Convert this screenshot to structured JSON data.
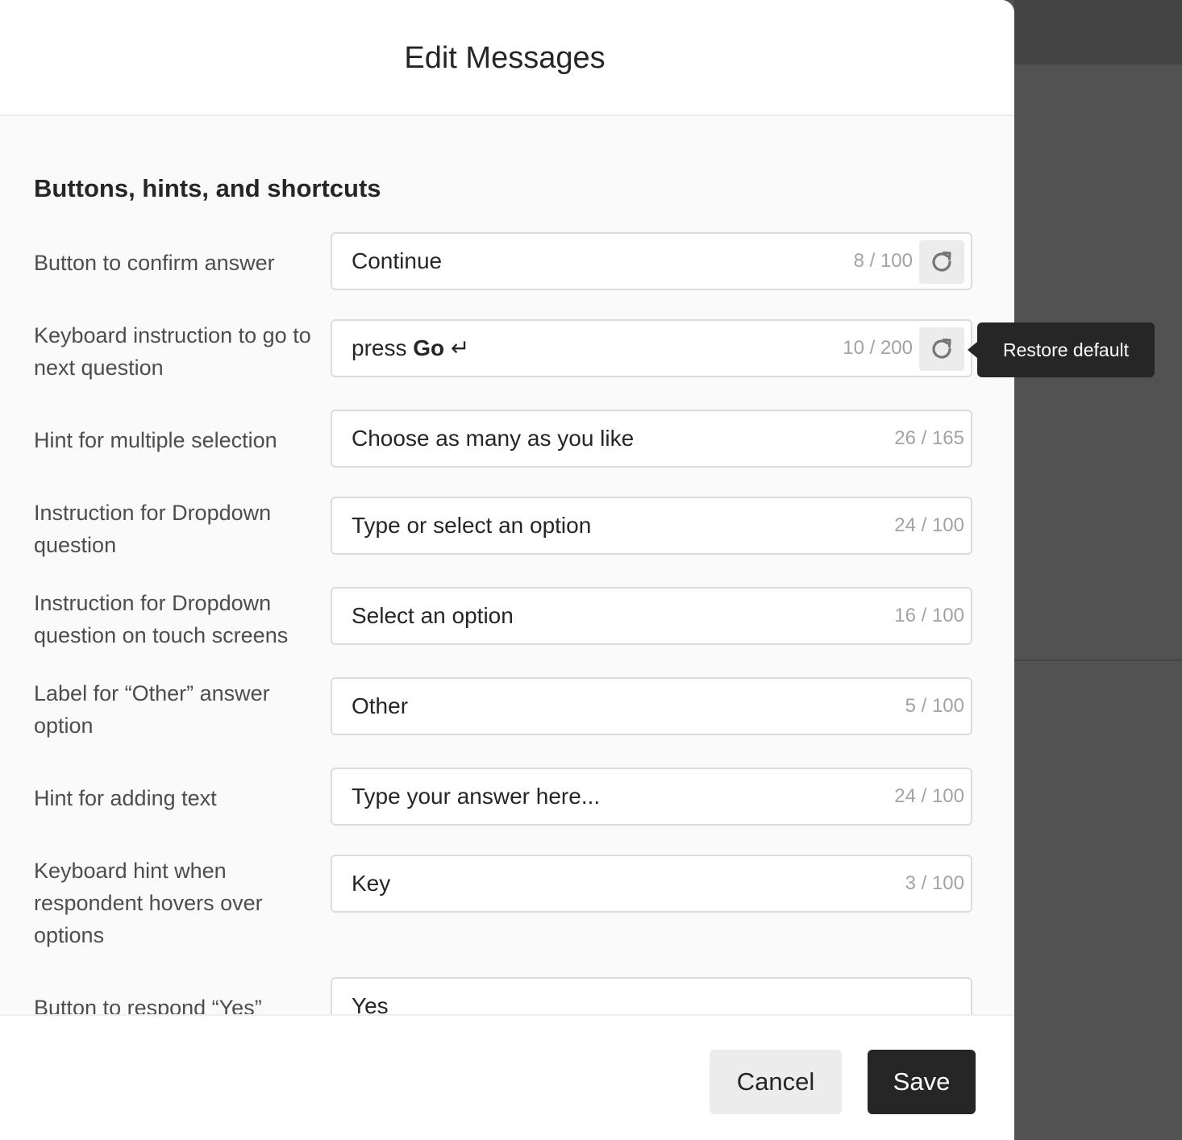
{
  "dialog": {
    "title": "Edit Messages",
    "section_title": "Buttons, hints, and shortcuts",
    "rows": [
      {
        "label": "Button to confirm answer",
        "value": "Continue",
        "counter": "8 / 100"
      },
      {
        "label": "Keyboard instruction to go to next question",
        "value_prefix": "press ",
        "value_bold": "Go",
        "value_suffix": " ↵",
        "counter": "10 / 200"
      },
      {
        "label": "Hint for multiple selection",
        "value": "Choose as many as you like",
        "counter": "26 / 165"
      },
      {
        "label": "Instruction for Dropdown question",
        "value": "Type or select an option",
        "counter": "24 / 100"
      },
      {
        "label": "Instruction for Dropdown question on touch screens",
        "value": "Select an option",
        "counter": "16 / 100"
      },
      {
        "label": "Label for “Other” answer option",
        "value": "Other",
        "counter": "5 / 100"
      },
      {
        "label": "Hint for adding text",
        "value": "Type your answer here...",
        "counter": "24 / 100"
      },
      {
        "label": "Keyboard hint when respondent hovers over options",
        "value": "Key",
        "counter": "3 / 100"
      },
      {
        "label": "Button to respond “Yes”",
        "value": "Yes",
        "counter": ""
      }
    ],
    "tooltip": "Restore default",
    "footer": {
      "cancel_label": "Cancel",
      "save_label": "Save"
    }
  },
  "icons": {
    "restore": "restore-icon"
  },
  "colors": {
    "primary": "#262626",
    "overlay": "#525252",
    "muted": "#a3a3a3"
  }
}
